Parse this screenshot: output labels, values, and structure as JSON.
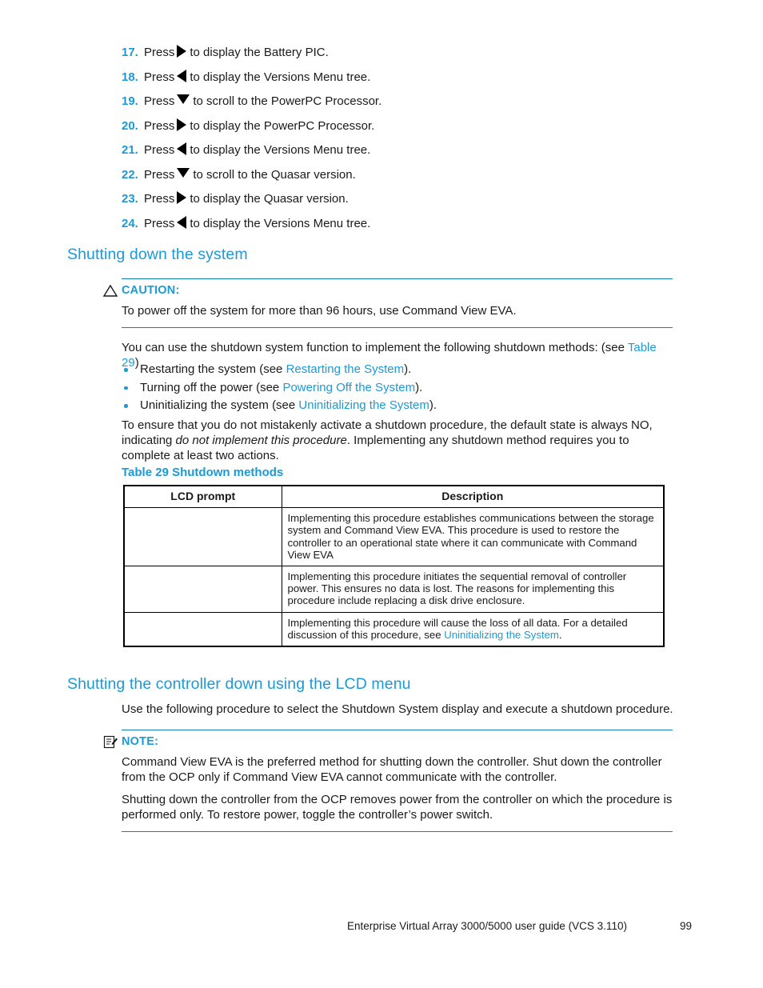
{
  "document": {
    "footer_title": "Enterprise Virtual Array 3000/5000 user guide (VCS 3.110)",
    "footer_page": "99"
  },
  "steps": [
    {
      "num": "17.",
      "pre": "Press",
      "icon": "triangle-right-icon",
      "post": "to display the Battery PIC."
    },
    {
      "num": "18.",
      "pre": "Press",
      "icon": "triangle-left-icon",
      "post": "to display the Versions Menu tree."
    },
    {
      "num": "19.",
      "pre": "Press",
      "icon": "triangle-down-icon",
      "post": "to scroll to the PowerPC Processor."
    },
    {
      "num": "20.",
      "pre": "Press",
      "icon": "triangle-right-icon",
      "post": "to display the PowerPC Processor."
    },
    {
      "num": "21.",
      "pre": "Press",
      "icon": "triangle-left-icon",
      "post": "to display the Versions Menu tree."
    },
    {
      "num": "22.",
      "pre": "Press",
      "icon": "triangle-down-icon",
      "post": "to scroll to the Quasar version."
    },
    {
      "num": "23.",
      "pre": "Press",
      "icon": "triangle-right-icon",
      "post": "to display the Quasar version."
    },
    {
      "num": "24.",
      "pre": "Press",
      "icon": "triangle-left-icon",
      "post": "to display the Versions Menu tree."
    }
  ],
  "section_shutting_down": {
    "heading": "Shutting down the system",
    "caution": {
      "icon": "warning-triangle-icon",
      "label": "CAUTION:",
      "body": "To power off the system for more than 96 hours, use Command View EVA."
    },
    "intro_lead": "You can use the shutdown system function to implement the following shutdown methods: (see ",
    "intro_link": "Table 29",
    "intro_tail": ")",
    "bullets": [
      {
        "lead": "Restarting the system (see ",
        "link": "Restarting the System",
        "tail": ")."
      },
      {
        "lead": "Turning off the power (see ",
        "link": "Powering Off the System",
        "tail": ")."
      },
      {
        "lead": "Uninitializing the system (see ",
        "link": "Uninitializing the System",
        "tail": ")."
      }
    ],
    "note_paragraph_lead": "To ensure that you do not mistakenly activate a shutdown procedure, the default state is always NO, indicating ",
    "note_paragraph_italic": "do not implement this procedure",
    "note_paragraph_tail": ". Implementing any shutdown method requires you to complete at least two actions."
  },
  "table": {
    "caption": "Table 29 Shutdown methods",
    "headers": [
      "LCD prompt",
      "Description"
    ],
    "rows": [
      {
        "prompt": "",
        "description": "Implementing this procedure establishes communications between the storage system and Command View EVA. This procedure is used to restore the controller to an operational state where it can communicate with Command View EVA",
        "description_link": "",
        "description_tail": ""
      },
      {
        "prompt": "",
        "description": "Implementing this procedure initiates the sequential removal of controller power. This ensures no data is lost. The reasons for implementing this procedure include replacing a disk drive enclosure.",
        "description_link": "",
        "description_tail": ""
      },
      {
        "prompt": "",
        "description": "Implementing this procedure will cause the loss of all data. For a detailed discussion of this procedure, see ",
        "description_link": "Uninitializing the System",
        "description_tail": "."
      }
    ]
  },
  "section_shutting_controller": {
    "heading": "Shutting the controller down using the LCD menu",
    "intro": "Use the following procedure to select the Shutdown System display and execute a shutdown procedure.",
    "note": {
      "icon": "note-pad-icon",
      "label": "NOTE:",
      "paragraph_1": "Command View EVA is the preferred method for shutting down the controller. Shut down the controller from the OCP only if Command View EVA cannot communicate with the controller.",
      "paragraph_2": "Shutting down the controller from the OCP removes power from the controller on which the procedure is performed only. To restore power, toggle the controller’s power switch."
    }
  },
  "colors": {
    "heading_blue": "#1b9ad6",
    "rule_blue": "#1380b4",
    "text_black": "#1a1a1a"
  }
}
